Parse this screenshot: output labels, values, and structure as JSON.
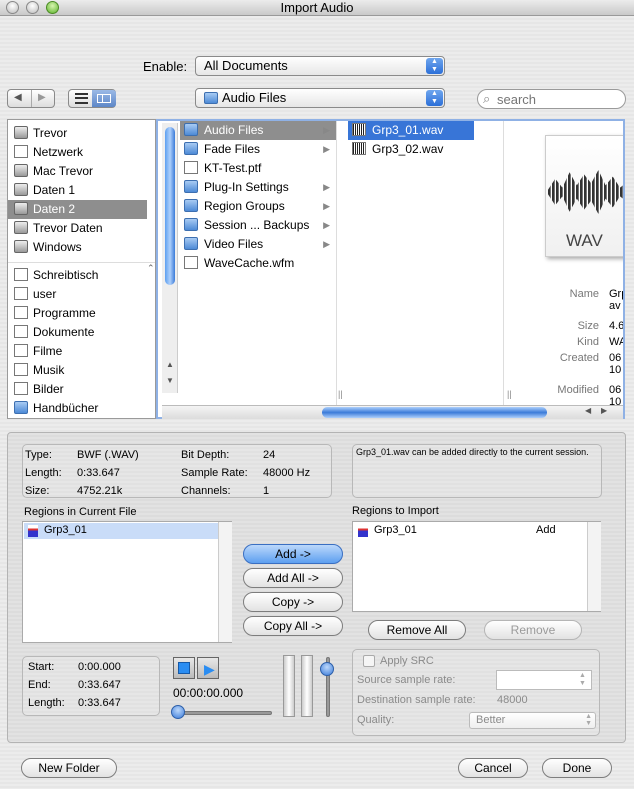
{
  "window": {
    "title": "Import Audio"
  },
  "enable": {
    "label": "Enable:",
    "value": "All Documents"
  },
  "location": {
    "value": "Audio Files"
  },
  "search": {
    "placeholder": "search"
  },
  "sidebar": {
    "devices": [
      {
        "label": "Trevor",
        "icon": "computer-icon"
      },
      {
        "label": "Netzwerk",
        "icon": "network-globe-icon"
      },
      {
        "label": "Mac Trevor",
        "icon": "hard-drive-icon"
      },
      {
        "label": "Daten 1",
        "icon": "hard-drive-icon"
      },
      {
        "label": "Daten 2",
        "icon": "hard-drive-icon",
        "selected": true
      },
      {
        "label": "Trevor Daten",
        "icon": "hard-drive-icon"
      },
      {
        "label": "Windows",
        "icon": "hard-drive-icon"
      }
    ],
    "places": [
      {
        "label": "Schreibtisch",
        "icon": "desktop-icon"
      },
      {
        "label": "user",
        "icon": "home-icon"
      },
      {
        "label": "Programme",
        "icon": "applications-icon"
      },
      {
        "label": "Dokumente",
        "icon": "documents-icon"
      },
      {
        "label": "Filme",
        "icon": "movies-icon"
      },
      {
        "label": "Musik",
        "icon": "music-icon"
      },
      {
        "label": "Bilder",
        "icon": "pictures-icon"
      },
      {
        "label": "Handbücher",
        "icon": "folder-icon"
      }
    ]
  },
  "column1": [
    {
      "label": "Audio Files",
      "icon": "folder-icon",
      "arrow": true,
      "selected": true
    },
    {
      "label": "Fade Files",
      "icon": "folder-icon",
      "arrow": true
    },
    {
      "label": "KT-Test.ptf",
      "icon": "session-file-icon",
      "arrow": false
    },
    {
      "label": "Plug-In Settings",
      "icon": "folder-icon",
      "arrow": true
    },
    {
      "label": "Region Groups",
      "icon": "folder-icon",
      "arrow": true
    },
    {
      "label": "Session ... Backups",
      "icon": "folder-icon",
      "arrow": true
    },
    {
      "label": "Video Files",
      "icon": "folder-icon",
      "arrow": true
    },
    {
      "label": "WaveCache.wfm",
      "icon": "wavecache-file-icon",
      "arrow": false
    }
  ],
  "column2": [
    {
      "label": "Grp3_01.wav",
      "icon": "wav-file-icon",
      "selected": true
    },
    {
      "label": "Grp3_02.wav",
      "icon": "wav-file-icon"
    }
  ],
  "preview": {
    "badge": "WAV",
    "fields": [
      {
        "label": "Name",
        "value": "Grp av"
      },
      {
        "label": "Size",
        "value": "4.6"
      },
      {
        "label": "Kind",
        "value": "WA"
      },
      {
        "label": "Created",
        "value": "06 10"
      },
      {
        "label": "Modified",
        "value": "06 10"
      }
    ]
  },
  "fileinfo": {
    "type_label": "Type:",
    "type_value": "BWF (.WAV)",
    "length_label": "Length:",
    "length_value": "0:33.647",
    "size_label": "Size:",
    "size_value": "4752.21k",
    "bitdepth_label": "Bit Depth:",
    "bitdepth_value": "24",
    "samplerate_label": "Sample Rate:",
    "samplerate_value": "48000 Hz",
    "channels_label": "Channels:",
    "channels_value": "1"
  },
  "message": "Grp3_01.wav can be added directly to the current session.",
  "regions_current": {
    "label": "Regions in Current File",
    "items": [
      "Grp3_01"
    ]
  },
  "regions_import": {
    "label": "Regions to Import",
    "items": [
      {
        "name": "Grp3_01",
        "action": "Add"
      }
    ]
  },
  "buttons": {
    "add": "Add ->",
    "add_all": "Add All ->",
    "copy": "Copy ->",
    "copy_all": "Copy All ->",
    "remove_all": "Remove All",
    "remove": "Remove",
    "new_folder": "New Folder",
    "cancel": "Cancel",
    "done": "Done"
  },
  "playback": {
    "start_label": "Start:",
    "start_value": "0:00.000",
    "end_label": "End:",
    "end_value": "0:33.647",
    "length_label": "Length:",
    "length_value": "0:33.647",
    "time": "00:00:00.000",
    "position": 0,
    "volume": 0.85
  },
  "src": {
    "apply_label": "Apply SRC",
    "source_label": "Source sample rate:",
    "dest_label": "Destination sample rate:",
    "dest_value": "48000",
    "quality_label": "Quality:",
    "quality_value": "Better"
  },
  "colors": {
    "selection": "#3875d7",
    "blue_button": "#5d9ff0"
  }
}
